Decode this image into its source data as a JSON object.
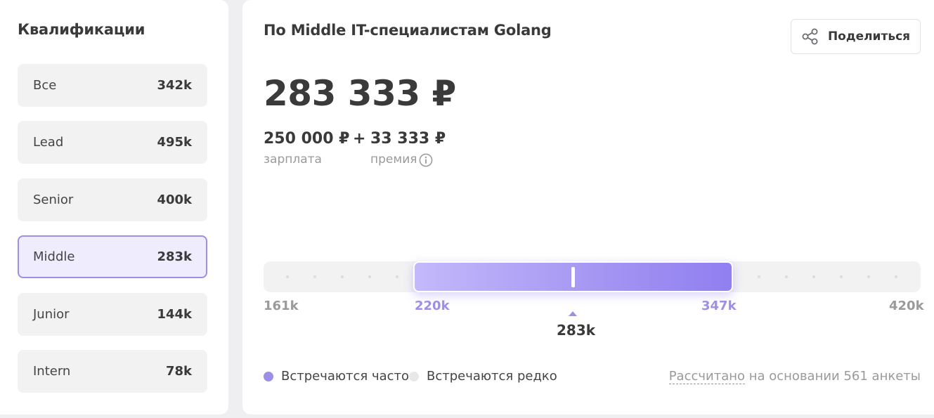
{
  "sidebar": {
    "title": "Квалификации",
    "items": [
      {
        "name": "Все",
        "count": "342k"
      },
      {
        "name": "Lead",
        "count": "495k"
      },
      {
        "name": "Senior",
        "count": "400k"
      },
      {
        "name": "Middle",
        "count": "283k"
      },
      {
        "name": "Junior",
        "count": "144k"
      },
      {
        "name": "Intern",
        "count": "78k"
      }
    ]
  },
  "main": {
    "title": "По Middle IT-специалистам Golang",
    "share_label": "Поделиться",
    "total": "283 333 ₽",
    "salary_value": "250 000 ₽",
    "plus": "+",
    "bonus_value": "33 333 ₽",
    "salary_label": "зарплата",
    "bonus_label": "премия"
  },
  "range": {
    "min_label": "161k",
    "low_label": "220k",
    "high_label": "347k",
    "max_label": "420k",
    "median_label": "283k"
  },
  "legend": {
    "frequent": "Встречаются часто",
    "rare": "Встречаются редко"
  },
  "footnote": {
    "link": "Рассчитано",
    "rest": " на основании 561 анкеты"
  },
  "colors": {
    "accent": "#9d8fe6",
    "active_bg": "#efecfd",
    "frequent_dot": "#9d8fe6",
    "rare_dot": "#e8e8ea"
  }
}
